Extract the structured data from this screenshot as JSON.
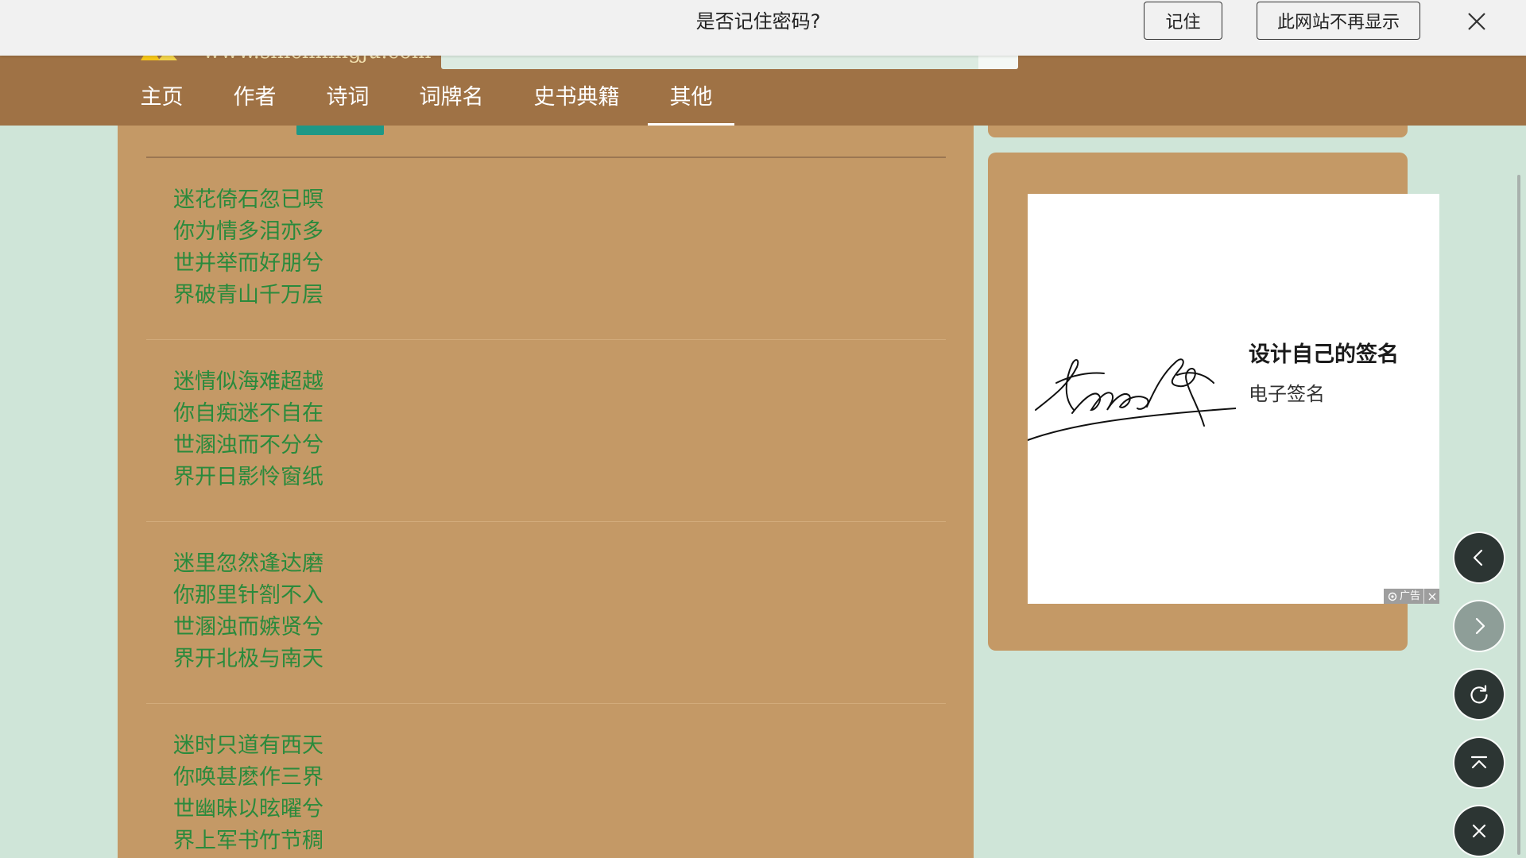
{
  "password_prompt": {
    "message": "是否记住密码?",
    "remember_label": "记住",
    "never_label": "此网站不再显示",
    "close_icon": "close-icon"
  },
  "header": {
    "logo_icon": "site-logo-icon",
    "logo_text": "www.shicimingju.com",
    "search_button_icon": "search-button-icon",
    "nav": [
      "主页",
      "作者",
      "诗词",
      "词牌名",
      "史书典籍",
      "其他"
    ]
  },
  "poems": [
    {
      "lines": [
        "迷花倚石忽已暝",
        "你为情多泪亦多",
        "世并举而好朋兮",
        "界破青山千万层"
      ]
    },
    {
      "lines": [
        "迷情似海难超越",
        "你自痴迷不自在",
        "世溷浊而不分兮",
        "界开日影怜窗纸"
      ]
    },
    {
      "lines": [
        "迷里忽然逢达磨",
        "你那里针劄不入",
        "世溷浊而嫉贤兮",
        "界开北极与南天"
      ]
    },
    {
      "lines": [
        "迷时只道有西天",
        "你唤甚麽作三界",
        "世幽昧以昡曜兮",
        "界上军书竹节稠"
      ]
    }
  ],
  "ad": {
    "image": "signature-image",
    "title": "设计自己的签名",
    "subtitle": "电子签名",
    "badge_icon": "ad-choices-icon",
    "badge_label": "广告",
    "close_icon": "close-icon"
  },
  "floating_controls": [
    {
      "icon": "chevron-left-icon",
      "enabled": true
    },
    {
      "icon": "chevron-right-icon",
      "enabled": false
    },
    {
      "icon": "refresh-icon",
      "enabled": true
    },
    {
      "icon": "scroll-to-top-icon",
      "enabled": true
    },
    {
      "icon": "close-icon",
      "enabled": true
    }
  ],
  "colors": {
    "page_bg": "#cfe5d8",
    "header_bg": "#9f7245",
    "card_bg": "#c49966",
    "poem_text": "#2a8a3c",
    "accent_tab": "#1e9886",
    "prompt_bg": "#f1f1f1",
    "fab_dark": "#2c3533",
    "fab_light": "#8e9e98"
  }
}
